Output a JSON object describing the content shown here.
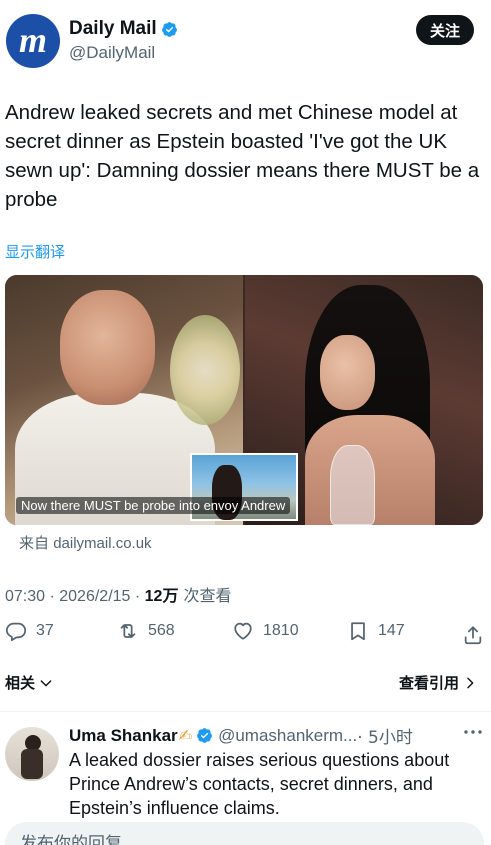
{
  "author": {
    "display_name": "Daily Mail",
    "handle": "@DailyMail",
    "avatar_letter": "m",
    "verified": true,
    "follow_label": "关注"
  },
  "tweet": {
    "text": "Andrew leaked secrets and met Chinese model at secret dinner as Epstein boasted 'I've got the UK sewn up': Damning dossier means there MUST be a probe",
    "translate_label": "显示翻译"
  },
  "media": {
    "caption": "Now there MUST be probe into envoy Andrew",
    "source_prefix": "来自",
    "source_domain": "dailymail.co.uk"
  },
  "meta": {
    "time_date": "07:30 · 2026/2/15 · ",
    "views_count": "12万",
    "views_label": " 次查看"
  },
  "actions": {
    "replies": "37",
    "retweets": "568",
    "likes": "1810",
    "bookmarks": "147"
  },
  "related": {
    "label": "相关",
    "quotes_label": "查看引用"
  },
  "reply": {
    "name": "Uma Shankar",
    "emoji": "✍",
    "handle": "@umashankerm...",
    "time": "· 5小时",
    "text": "A leaked dossier raises serious questions about Prince Andrew’s contacts, secret dinners, and Epstein’s influence claims."
  },
  "compose": {
    "placeholder": "发布你的回复"
  },
  "colors": {
    "accent": "#1d9bf0",
    "secondary_text": "#536471",
    "primary_text": "#0f1419",
    "avatar_bg": "#1b4fa8"
  }
}
